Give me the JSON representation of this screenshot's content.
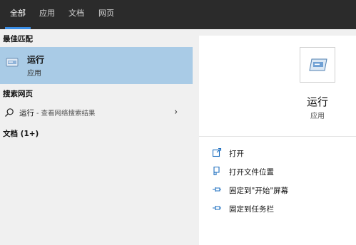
{
  "tabs": [
    {
      "label": "全部",
      "active": true
    },
    {
      "label": "应用",
      "active": false
    },
    {
      "label": "文档",
      "active": false
    },
    {
      "label": "网页",
      "active": false
    }
  ],
  "best_match": {
    "heading": "最佳匹配",
    "title": "运行",
    "subtitle": "应用",
    "icon": "run-app-icon"
  },
  "web_search": {
    "heading": "搜索网页",
    "query": "运行",
    "suffix": " - 查看网络搜索结果",
    "chevron": "›"
  },
  "documents": {
    "heading": "文档 (1+)"
  },
  "preview": {
    "app_name": "运行",
    "app_type": "应用",
    "actions": [
      {
        "label": "打开",
        "icon": "open-icon"
      },
      {
        "label": "打开文件位置",
        "icon": "file-location-icon"
      },
      {
        "label": "固定到\"开始\"屏幕",
        "icon": "pin-start-icon"
      },
      {
        "label": "固定到任务栏",
        "icon": "pin-taskbar-icon"
      }
    ]
  },
  "colors": {
    "accent": "#3a8ee6",
    "selected_bg": "#a9cbe6",
    "topbar_bg": "#2b2b2b",
    "icon_blue": "#1e6fc0"
  }
}
